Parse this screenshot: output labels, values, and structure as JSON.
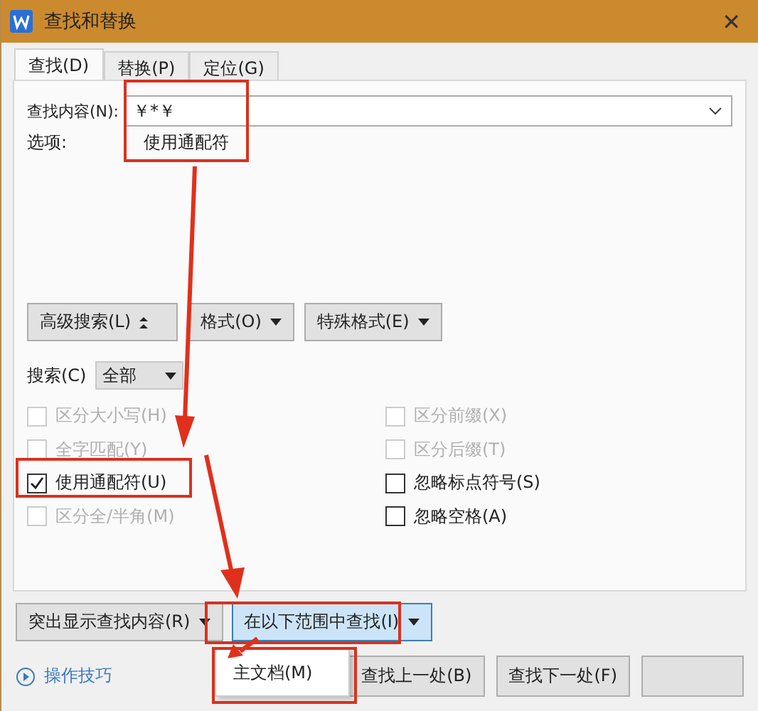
{
  "window": {
    "title": "查找和替换",
    "close": "✕"
  },
  "tabs": [
    {
      "label": "查找(D)",
      "selected": true
    },
    {
      "label": "替换(P)",
      "selected": false
    },
    {
      "label": "定位(G)",
      "selected": false
    }
  ],
  "find": {
    "label": "查找内容(N):",
    "value": "￥*￥"
  },
  "options": {
    "label": "选项:",
    "value": "使用通配符"
  },
  "format_buttons": [
    {
      "label": "高级搜索(L)",
      "kind": "collapse"
    },
    {
      "label": "格式(O)",
      "kind": "dropdown"
    },
    {
      "label": "特殊格式(E)",
      "kind": "dropdown"
    }
  ],
  "search": {
    "label": "搜索(C)",
    "value": "全部"
  },
  "checkboxes_left": [
    {
      "label": "区分大小写(H)",
      "checked": false,
      "disabled": true
    },
    {
      "label": "全字匹配(Y)",
      "checked": false,
      "disabled": true
    },
    {
      "label": "使用通配符(U)",
      "checked": true,
      "disabled": false
    },
    {
      "label": "区分全/半角(M)",
      "checked": false,
      "disabled": true
    }
  ],
  "checkboxes_right": [
    {
      "label": "区分前缀(X)",
      "checked": false,
      "disabled": true
    },
    {
      "label": "区分后缀(T)",
      "checked": false,
      "disabled": true
    },
    {
      "label": "忽略标点符号(S)",
      "checked": false,
      "disabled": false
    },
    {
      "label": "忽略空格(A)",
      "checked": false,
      "disabled": false
    }
  ],
  "bottom_buttons": [
    {
      "label": "突出显示查找内容(R)",
      "selected": false
    },
    {
      "label": "在以下范围中查找(I)",
      "selected": true
    }
  ],
  "tips_link": "操作技巧",
  "menu": [
    {
      "label": "主文档(M)"
    }
  ],
  "action_buttons": [
    {
      "kind": "text",
      "label": "查找上一处(B)"
    },
    {
      "kind": "text",
      "label": "查找下一处(F)"
    },
    {
      "kind": "blank"
    }
  ]
}
